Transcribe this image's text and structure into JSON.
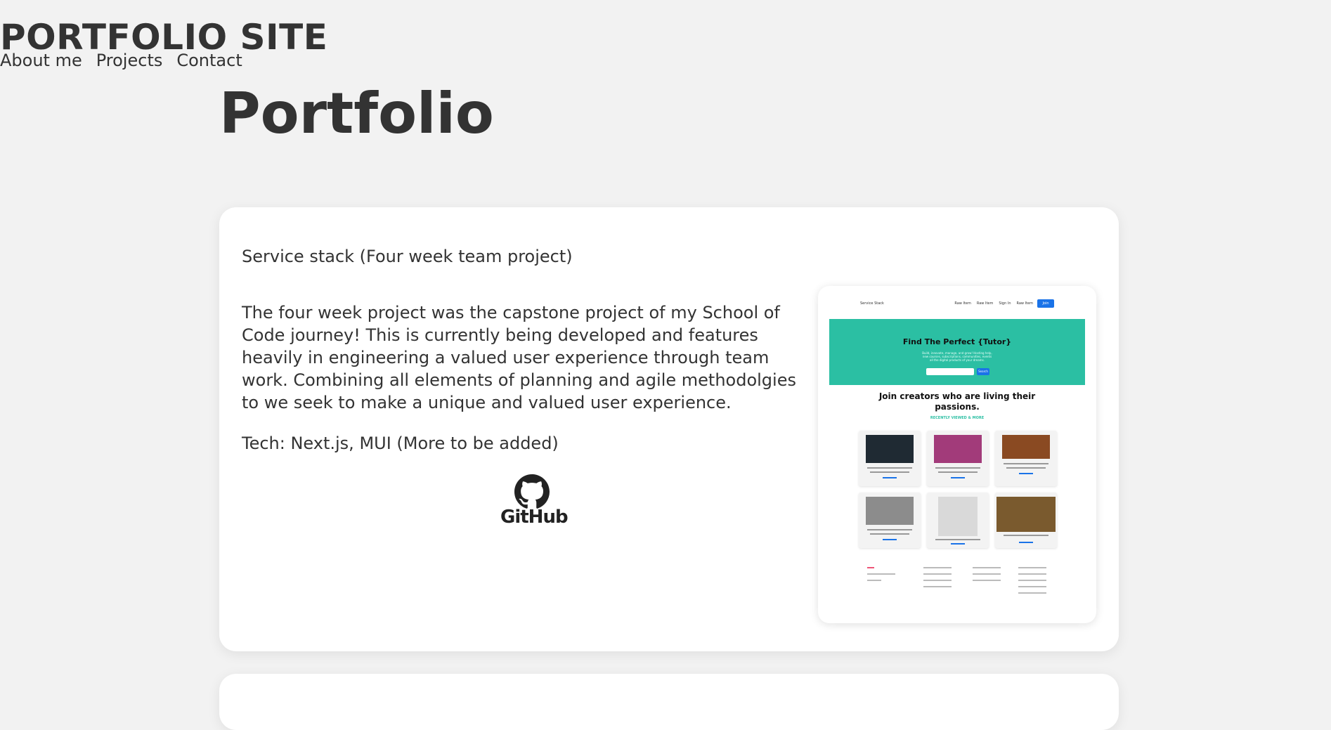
{
  "site": {
    "title": "PORTFOLIO SITE",
    "nav": [
      "About me",
      "Projects",
      "Contact"
    ]
  },
  "page": {
    "heading": "Portfolio"
  },
  "project": {
    "title": "Service stack (Four week team project)",
    "description": "The four week project was the capstone project of my School of Code journey! This is currently being developed and features heavily in engineering a valued user experience through team work. Combining all elements of planning and agile methodolgies to we seek to make a unique and valued user experience.",
    "tech": "Tech: Next.js, MUI (More to be added)",
    "github_label": "GitHub",
    "preview": {
      "logo": "Service Stack",
      "nav_links": [
        "Raw Item",
        "Raw Item",
        "Sign In",
        "Raw Item"
      ],
      "join_button": "Join",
      "hero_title": "Find The Perfect {Tutor}",
      "hero_subtitle": "Build, innovate, manage, and grow! Hosting help, new courses, subscriptions, communities, events all the digital products of your dreams.",
      "search_button": "Search",
      "join_heading": "Join creators who are living their passions.",
      "recent_label": "RECENTLY VIEWED & MORE"
    }
  },
  "colors": {
    "background": "#f2f2f2",
    "card": "#ffffff",
    "text": "#333333",
    "preview_hero": "#2bbfa3",
    "preview_accent": "#1a73e8"
  }
}
